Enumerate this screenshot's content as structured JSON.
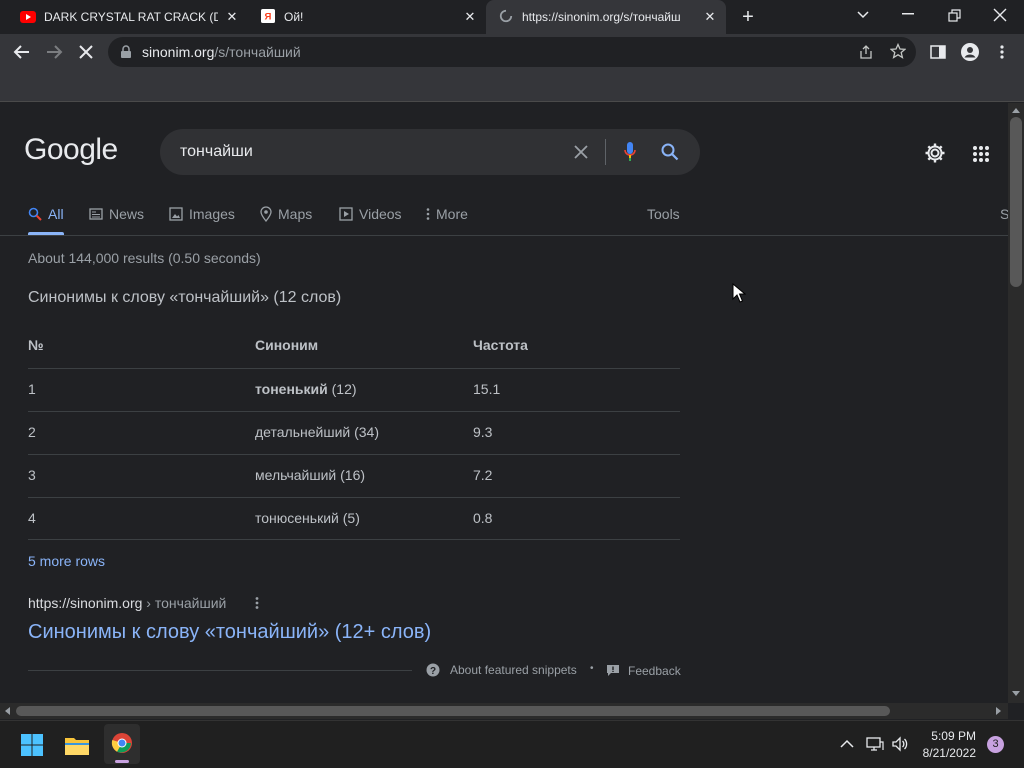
{
  "browser": {
    "tabs": [
      {
        "title": "DARK CRYSTAL RAT CRACK (DCR",
        "icon": "youtube-icon"
      },
      {
        "title": "Ой!",
        "icon": "yandex-icon"
      },
      {
        "title": "https://sinonim.org/s/тончайш",
        "icon": "loading-spinner-icon"
      }
    ],
    "address": {
      "domain": "sinonim.org",
      "path": "/s/тончайший"
    }
  },
  "search": {
    "logo": "Google",
    "query": "тончайши",
    "tabs": [
      {
        "label": "All"
      },
      {
        "label": "News"
      },
      {
        "label": "Images"
      },
      {
        "label": "Maps"
      },
      {
        "label": "Videos"
      },
      {
        "label": "More"
      }
    ],
    "tools_label": "Tools",
    "cut_label": "S",
    "stats": "About 144,000 results (0.50 seconds)"
  },
  "snippet": {
    "heading": "Синонимы к слову «тончайший» (12 слов)",
    "table": {
      "headers": [
        "№",
        "Синоним",
        "Частота"
      ],
      "rows": [
        {
          "num": "1",
          "word": "тоненький",
          "count": "(12)",
          "freq": "15.1"
        },
        {
          "num": "2",
          "word": "детальнейший",
          "count": "(34)",
          "freq": "9.3"
        },
        {
          "num": "3",
          "word": "мельчайший",
          "count": "(16)",
          "freq": "7.2"
        },
        {
          "num": "4",
          "word": "тонюсенький",
          "count": "(5)",
          "freq": "0.8"
        }
      ]
    },
    "more_rows": "5 more rows",
    "source_domain": "https://sinonim.org",
    "source_path": "› тончайший",
    "result_title": "Синонимы к слову «тончайший» (12+ слов)",
    "about_label": "About featured snippets",
    "separator": "•",
    "feedback_label": "Feedback"
  },
  "taskbar": {
    "time": "5:09 PM",
    "date": "8/21/2022",
    "notifications": "3"
  },
  "colors": {
    "link": "#8ab4f8",
    "accent_blue": "#8ab4f8",
    "bg": "#202124"
  }
}
